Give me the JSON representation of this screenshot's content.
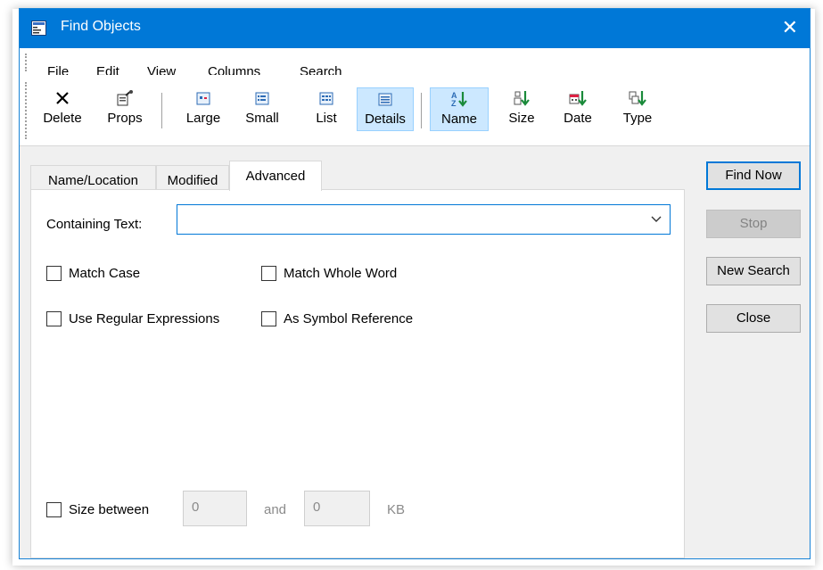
{
  "window": {
    "title": "Find Objects",
    "close_glyph": "✕"
  },
  "menu": [
    "File",
    "Edit",
    "View",
    "Columns",
    "Search"
  ],
  "toolbar": {
    "delete": "Delete",
    "props": "Props",
    "large": "Large",
    "small": "Small",
    "list": "List",
    "details": "Details",
    "name": "Name",
    "size": "Size",
    "date": "Date",
    "type": "Type"
  },
  "tabs": [
    "Name/Location",
    "Modified",
    "Advanced"
  ],
  "advanced": {
    "containing_text_label": "Containing Text:",
    "containing_text_value": "",
    "match_case": "Match Case",
    "match_whole_word": "Match Whole Word",
    "use_regex": "Use Regular Expressions",
    "as_symbol_ref": "As Symbol Reference",
    "size_between": "Size between",
    "size_min": "0",
    "and_label": "and",
    "size_max": "0",
    "unit": "KB"
  },
  "buttons": {
    "find_now": "Find Now",
    "stop": "Stop",
    "new_search": "New Search",
    "close": "Close"
  }
}
